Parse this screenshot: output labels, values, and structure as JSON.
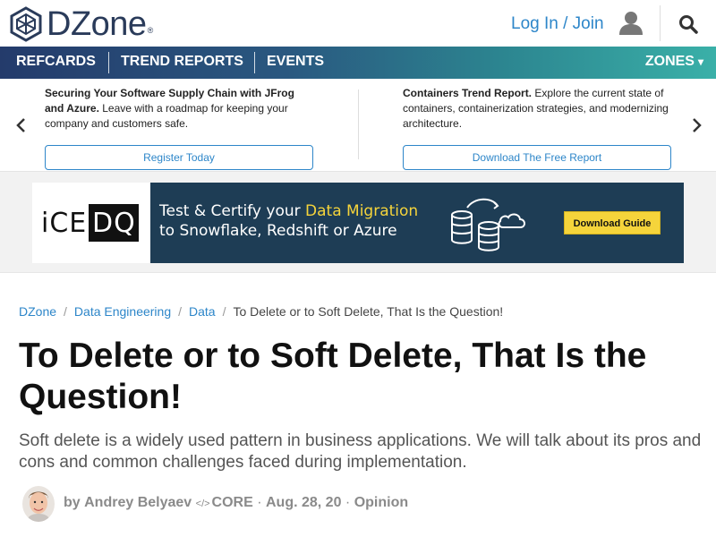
{
  "header": {
    "logo_text": "DZone",
    "logo_reg": "®",
    "login_label": "Log In / Join"
  },
  "nav": {
    "items": [
      "REFCARDS",
      "TREND REPORTS",
      "EVENTS"
    ],
    "zones_label": "ZONES",
    "zones_caret": "▾"
  },
  "promo": {
    "left": {
      "bold": "Securing Your Software Supply Chain with JFrog and Azure.",
      "text": " Leave with a roadmap for keeping your company and customers safe.",
      "button": "Register Today"
    },
    "right": {
      "bold": "Containers Trend Report.",
      "text": " Explore the current state of containers, containerization strategies, and modernizing architecture.",
      "button": "Download The Free Report"
    }
  },
  "ad": {
    "logo_left": "iCE",
    "logo_box": "DQ",
    "line1_prefix": "Test & Certify your ",
    "line1_highlight": "Data Migration",
    "line2": "to Snowflake, Redshift or Azure",
    "button": "Download Guide",
    "colors": {
      "background": "#1e3d55",
      "highlight": "#f5d43b"
    }
  },
  "article": {
    "breadcrumb": [
      "DZone",
      "Data Engineering",
      "Data",
      "To Delete or to Soft Delete, That Is the Question!"
    ],
    "title": "To Delete or to Soft Delete, That Is the Question!",
    "subtitle": "Soft delete is a widely used pattern in business applications. We will talk about its pros and cons and common challenges faced during implementation.",
    "byline": {
      "by": "by",
      "author": "Andrey Belyaev",
      "core_icon": "</>",
      "core_label": "CORE",
      "sep1": " · ",
      "date": "Aug. 28, 20",
      "sep2": " · ",
      "category": "Opinion"
    }
  },
  "colors": {
    "link": "#2d86c9",
    "brand": "#2a3b5a"
  }
}
